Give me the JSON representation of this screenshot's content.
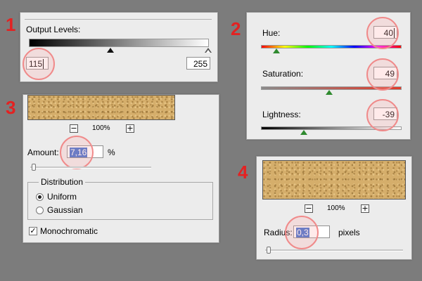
{
  "steps": [
    "1",
    "2",
    "3",
    "4"
  ],
  "levels": {
    "label": "Output Levels:",
    "low_value": "115",
    "high_value": "255"
  },
  "hue_sat": {
    "hue_label": "Hue:",
    "hue_value": "40",
    "saturation_label": "Saturation:",
    "saturation_value": "49",
    "lightness_label": "Lightness:",
    "lightness_value": "-39"
  },
  "noise": {
    "zoom_minus": "−",
    "zoom_level": "100%",
    "zoom_plus": "+",
    "amount_label": "Amount:",
    "amount_value": "7,16",
    "amount_unit": "%",
    "distribution_label": "Distribution",
    "uniform_label": "Uniform",
    "gaussian_label": "Gaussian",
    "monochromatic_label": "Monochromatic",
    "check_mark": "✓"
  },
  "blur": {
    "zoom_minus": "−",
    "zoom_level": "100%",
    "zoom_plus": "+",
    "radius_label": "Radius:",
    "radius_value": "0,3",
    "radius_unit": "pixels"
  },
  "colors": {
    "step_number": "#e32222",
    "highlight_circle": "#f08a8a",
    "selection": "#3d6dcc",
    "sand": "#d5ae6b"
  }
}
